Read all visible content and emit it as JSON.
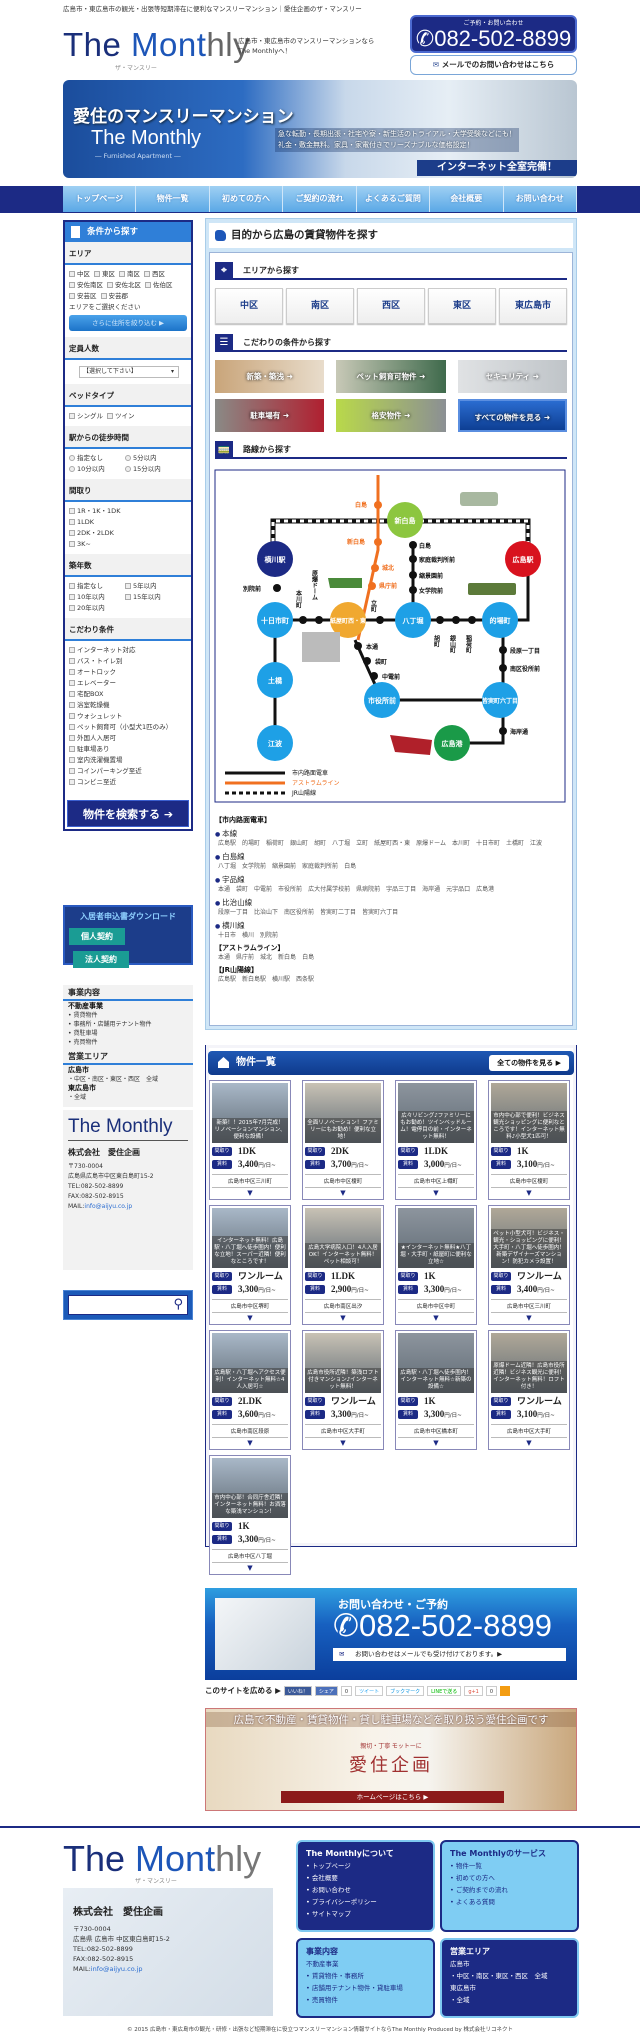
{
  "header": {
    "topline": "広島市・東広島市の観光・出張等短期滞在に便利なマンスリーマンション｜愛住企画のザ・マンスリー",
    "logo": "The Monthly",
    "logo_sub": "ザ・マンスリー",
    "tagline": "広島市・東広島市のマンスリーマンションなら The Monthlyへ！",
    "tel_label": "ご予約・お問い合わせ",
    "tel": "082-502-8899",
    "mail_button": "メールでのお問い合わせはこちら"
  },
  "hero": {
    "title": "愛住のマンスリーマンション",
    "brand": "The Monthly",
    "sub": "― Furnished Apartment ―",
    "copy1": "急な転勤・長期出張・社宅や寮・新生活のトライアル・大学受験などにも！",
    "copy2": "礼金・敷金無料。家具・家電付きでリーズナブルな価格設定！",
    "badge": "インターネット全室完備！"
  },
  "nav": [
    "トップページ",
    "物件一覧",
    "初めての方へ",
    "ご契約の流れ",
    "よくあるご質問",
    "会社概要",
    "お問い合わせ"
  ],
  "sidebar": {
    "title": "条件から探す",
    "area": {
      "label": "エリア",
      "options": [
        "中区",
        "東区",
        "南区",
        "西区",
        "安佐南区",
        "安佐北区",
        "佐伯区",
        "安芸区",
        "安芸郡"
      ],
      "hint": "エリアをご選択ください",
      "narrow": "さらに住所を絞り込む ▶"
    },
    "capacity": {
      "label": "定員人数",
      "select": "【選択して下さい】"
    },
    "bed": {
      "label": "ベッドタイプ",
      "options": [
        "シングル",
        "ツイン"
      ]
    },
    "walk": {
      "label": "駅からの徒歩時間",
      "options": [
        "指定なし",
        "5分以内",
        "10分以内",
        "15分以内"
      ]
    },
    "layout": {
      "label": "間取り",
      "options": [
        "1R・1K・1DK",
        "1LDK",
        "2DK・2LDK",
        "3K~"
      ]
    },
    "age": {
      "label": "築年数",
      "options": [
        "指定なし",
        "5年以内",
        "10年以内",
        "15年以内",
        "20年以内"
      ]
    },
    "features": {
      "label": "こだわり条件",
      "options": [
        "インターネット対応",
        "バス・トイレ別",
        "オートロック",
        "エレベーター",
        "宅配BOX",
        "浴室乾燥機",
        "ウォシュレット",
        "ペット飼育可（小型犬1匹のみ）",
        "外国人入居可",
        "駐車場あり",
        "室内洗濯機置場",
        "コインパーキング至近",
        "コンビニ至近"
      ]
    },
    "search_button": "物件を検索する"
  },
  "download": {
    "title": "入居者申込書ダウンロード",
    "personal": "個人契約",
    "corporate": "法人契約"
  },
  "business": {
    "title": "事業内容",
    "category": "不動産事業",
    "items": [
      "賃貸物件",
      "事務所・店舗用テナント物件",
      "貸駐車場",
      "売買物件"
    ],
    "area_title": "営業エリア",
    "city1": "広島市",
    "city1_areas": "・中区・南区・東区・西区　全域",
    "city2": "東広島市",
    "city2_areas": "・全域"
  },
  "company": {
    "logo": "The Monthly",
    "name": "株式会社　愛住企画",
    "zip": "〒730-0004",
    "address": "広島県広島市中区東白島町15-2",
    "tel": "TEL:082-502-8899",
    "fax": "FAX:082-502-8915",
    "mail_label": "MAIL:",
    "mail": "info@aijyu.co.jp"
  },
  "search_box": {
    "placeholder": ""
  },
  "main": {
    "title": "目的から広島の賃貸物件を探す",
    "area_heading": "エリアから探す",
    "areas": [
      "中区",
      "南区",
      "西区",
      "東区",
      "東広島市"
    ],
    "kodawari_heading": "こだわりの条件から探す",
    "kodawari": [
      "新築・築浅 ➜",
      "ペット飼育可物件 ➜",
      "セキュリティ ➜",
      "駐車場有 ➜",
      "格安物件 ➜",
      "すべての物件を見る ➜"
    ],
    "route_heading": "路線から探す"
  },
  "route_map": {
    "stations": {
      "shin_hakushima": "新白島",
      "yokogawa": "横川駅",
      "hiroshima": "広島駅",
      "tokaichi": "十日市町",
      "kamiyacho": "紙屋町西・東",
      "hatchobori": "八丁堀",
      "matoba": "的場町",
      "dobashi": "土橋",
      "eba": "江波",
      "shiyakusho": "市役所前",
      "minami6": "皆実町六丁目",
      "ujina_port": "広島港"
    },
    "small": {
      "hakushima": "白島",
      "katei": "家庭裁判所前",
      "shukkeien": "縮景園前",
      "jogakuin": "女学院前",
      "betsuin": "別院前",
      "honkawa": "本川町",
      "dome": "原爆ドーム",
      "tatemachi": "立町",
      "ebisu": "胡町",
      "kanayama": "銀山町",
      "inari": "稲荷町",
      "hondori": "本通",
      "fukuro": "袋町",
      "chuden": "中電前",
      "danbara": "段原一丁目",
      "minamiku": "南区役所前",
      "kaigan": "海岸通"
    },
    "astram": {
      "hakushima": "白島",
      "shin_hakushima": "新白島",
      "johoku": "城北",
      "kenchomae": "県庁前"
    },
    "legend": [
      "市内路面電車",
      "アストラムライン",
      "JR山陽線"
    ],
    "colors": {
      "tram": "#111111",
      "astram": "#f07020",
      "jr": "#111111",
      "station": "#1ea0e6",
      "navy": "#1c2a85",
      "red": "#d8121e",
      "green": "#8cc63f",
      "port": "#1a9a48",
      "orange": "#f0a830"
    }
  },
  "lines": [
    {
      "group": "【市内路面電車】"
    },
    {
      "name": "本線",
      "stations": [
        "広島駅",
        "的場町",
        "稲荷町",
        "銀山町",
        "胡町",
        "八丁堀",
        "立町",
        "紙屋町西・東",
        "原爆ドーム",
        "本川町",
        "十日市町",
        "土橋町",
        "江波"
      ]
    },
    {
      "name": "白島線",
      "stations": [
        "八丁堀",
        "女学院前",
        "縮景園前",
        "家庭裁判所前",
        "白島"
      ]
    },
    {
      "name": "宇品線",
      "stations": [
        "本通",
        "袋町",
        "中電前",
        "市役所前",
        "広大付属学校前",
        "県病院前",
        "宇品三丁目",
        "海岸通",
        "元宇品口",
        "広島港"
      ]
    },
    {
      "name": "比治山線",
      "stations": [
        "段原一丁目",
        "比治山下",
        "南区役所前",
        "皆実町二丁目",
        "皆実町六丁目"
      ]
    },
    {
      "name": "横川線",
      "stations": [
        "十日市",
        "横川",
        "別院前"
      ]
    },
    {
      "group": "【アストラムライン】",
      "stations": [
        "本通",
        "県庁前",
        "城北",
        "新白島",
        "白島"
      ]
    },
    {
      "group": "【JR山陽線】",
      "stations": [
        "広島駅",
        "新白島駅",
        "横川駅",
        "西条駅"
      ]
    }
  ],
  "listing": {
    "title": "物件一覧",
    "all_button": "全ての物件を見る ▶",
    "layout_tag": "間取り",
    "price_tag": "賃料",
    "unit": "円/日~",
    "items": [
      {
        "desc": "新築！！2015年7月完成！リノベーションマンション、便利な設備！",
        "layout": "1DK",
        "price": "3,400",
        "address": "広島市中区三川町"
      },
      {
        "desc": "全面リノベーション！ファミリーにもお勧め！便利な立地！",
        "layout": "2DK",
        "price": "3,700",
        "address": "広島市中区榎町"
      },
      {
        "desc": "広々リビング♪ファミリーにもお勧め！ツインベッドルーム！電停目の前・インターネット無料！",
        "layout": "1LDK",
        "price": "3,000",
        "address": "広島市中区上幟町"
      },
      {
        "desc": "市内中心部で便利！ビジネス観光ショッピングに便利なところです！インターネット無料♪小型犬1匹可！",
        "layout": "1K",
        "price": "3,100",
        "address": "広島市中区榎町"
      },
      {
        "desc": "インターネット無料！広島駅・八丁堀へ徒歩圏内！便利な立地！スーパー近隣！便利なところです！",
        "layout": "ワンルーム",
        "price": "3,300",
        "address": "広島市中区堺町"
      },
      {
        "desc": "広島大学病院入口！4人入居OK！インターネット無料！ペット相談可！",
        "layout": "1LDK",
        "price": "2,900",
        "address": "広島市南区出汐"
      },
      {
        "desc": "★インターネット無料★八丁堀・大手町・紙屋町に便利な立地☆",
        "layout": "1K",
        "price": "3,300",
        "address": "広島市中区中町"
      },
      {
        "desc": "ペット小型犬可！ビジネス・観光・ショッピングに便利！大手町・八丁堀へ徒歩圏内！新築デザイナーズマンション！防犯カメラ設置！",
        "layout": "ワンルーム",
        "price": "3,400",
        "address": "広島市中区三川町"
      },
      {
        "desc": "広島駅・八丁堀へアクセス便利！インターネット無料☆4人入居可☆",
        "layout": "2LDK",
        "price": "3,600",
        "address": "広島市南区段原"
      },
      {
        "desc": "広島市役所近隣！築浅ロフト付きマンション♪インターネット無料！",
        "layout": "ワンルーム",
        "price": "3,300",
        "address": "広島市中区大手町"
      },
      {
        "desc": "広島駅・八丁堀へ徒歩圏内！インターネット無料☆新築の設備☆",
        "layout": "1K",
        "price": "3,300",
        "address": "広島市中区橋本町"
      },
      {
        "desc": "原爆ドーム近隣！広島市役所近隣！ビジネス観光に便利！インターネット無料！ロフト付き！",
        "layout": "ワンルーム",
        "price": "3,100",
        "address": "広島市中区大手町"
      },
      {
        "desc": "市内中心部！合同庁舎近隣！インターネット無料！お洒落な築浅マンション！",
        "layout": "1K",
        "price": "3,300",
        "address": "広島市中区八丁堀"
      }
    ]
  },
  "contact": {
    "title": "お問い合わせ・ご予約",
    "tel": "082-502-8899",
    "mail": "お問い合わせはメールでも受け付けております。▶"
  },
  "social": {
    "label": "このサイトを広める ▶",
    "buttons": [
      "いいね！",
      "シェア",
      "0",
      "ツイート",
      "ブックマーク",
      "LINEで送る",
      "g+1",
      "0"
    ]
  },
  "aijyu_banner": {
    "headline": "広島で不動産・賃貸物件・貸し駐車場などを取り扱う愛住企画です",
    "motto": "親切・丁寧 モットーに",
    "name": "愛住企画",
    "button": "ホームページはこちら ▶"
  },
  "footer": {
    "logo": "The Monthly",
    "logo_sub": "ザ・マンスリー",
    "company": "株式会社　愛住企画",
    "zip": "〒730-0004",
    "address": "広島県 広島市 中区東白島町15-2",
    "tel": "TEL:082-502-8899",
    "fax": "FAX:082-502-8915",
    "mail_label": "MAIL:",
    "mail": "info@aijyu.co.jp",
    "about": {
      "title": "The Monthlyについて",
      "items": [
        "トップページ",
        "会社概要",
        "お問い合わせ",
        "プライバシーポリシー",
        "サイトマップ"
      ]
    },
    "services": {
      "title": "The Monthlyのサービス",
      "items": [
        "物件一覧",
        "初めての方へ",
        "ご契約までの流れ",
        "よくある質問"
      ]
    },
    "business": {
      "title": "事業内容",
      "category": "不動産事業",
      "items": [
        "賃貸物件・事務所",
        "店舗用テナント物件・貸駐車場",
        "売買物件"
      ]
    },
    "area": {
      "title": "営業エリア",
      "city1": "広島市",
      "city1_areas": "・中区・南区・東区・西区　全域",
      "city2": "東広島市",
      "city2_areas": "・全域"
    },
    "copyright": "© 2015 広島市・東広島市の観光・研修・出張など短期滞在に役立つマンスリーマンション情報サイトならThe Monthly Produced by 株式会社リコネクト"
  }
}
